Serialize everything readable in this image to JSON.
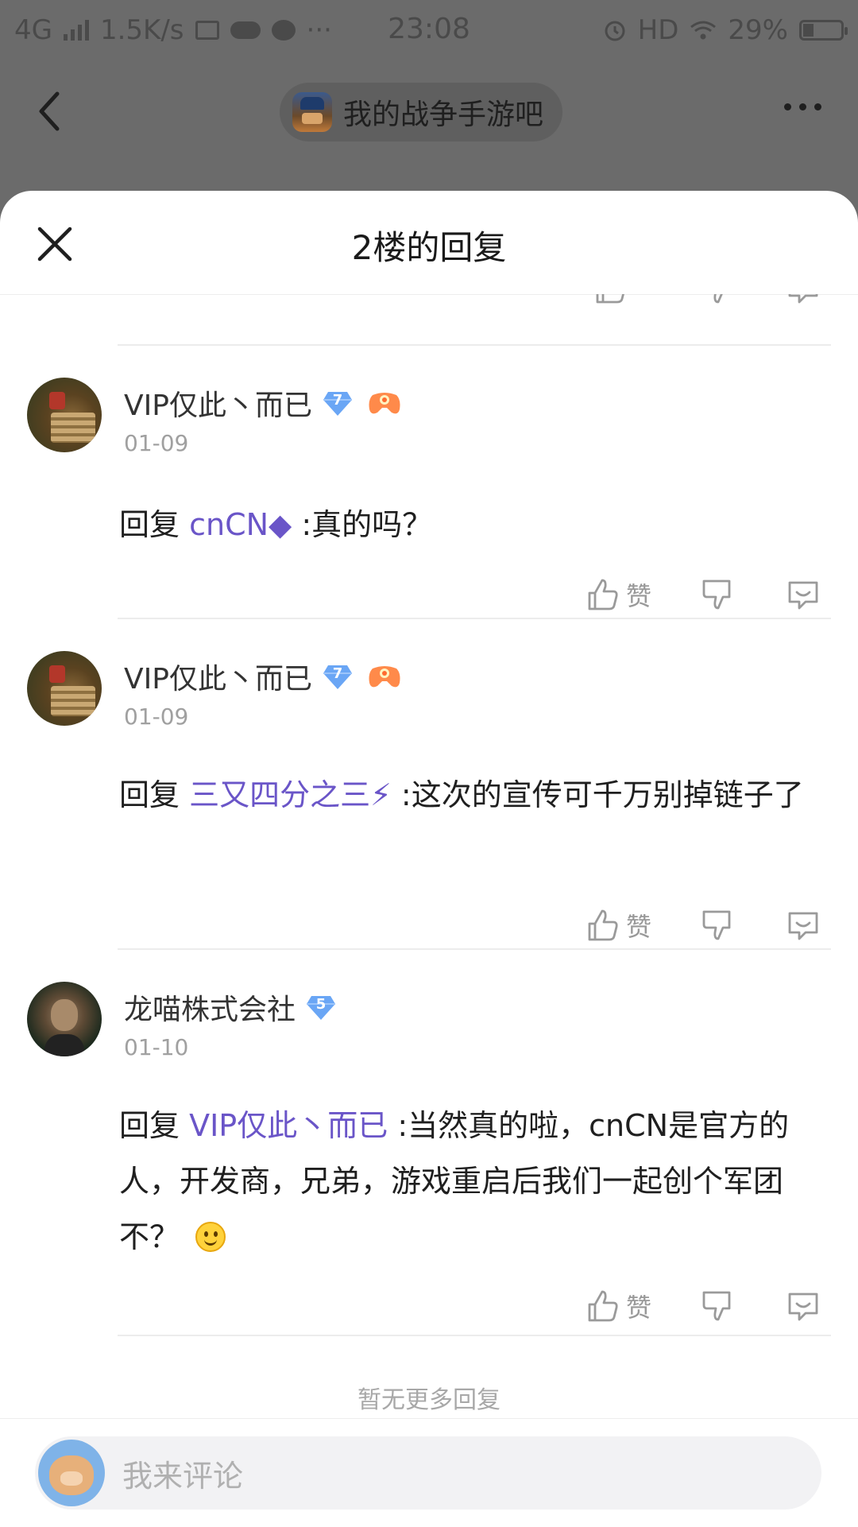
{
  "status_bar": {
    "network": "4G",
    "speed": "1.5K/s",
    "time": "23:08",
    "hd": "HD",
    "battery": "29%",
    "battery_level": 0.29
  },
  "nav": {
    "forum_name": "我的战争手游吧"
  },
  "sheet": {
    "title": "2楼的回复"
  },
  "replies": [
    {
      "username": "VIP仅此丶而已",
      "level": "7",
      "date": "01-09",
      "prefix": "回复",
      "mention": "cnCN◆",
      "text": ":真的吗？",
      "like_label": "赞"
    },
    {
      "username": "VIP仅此丶而已",
      "level": "7",
      "date": "01-09",
      "prefix": "回复",
      "mention": "三又四分之三⚡",
      "text": ":这次的宣传可千万别掉链子了",
      "like_label": "赞"
    },
    {
      "username": "龙喵株式会社",
      "level": "5",
      "date": "01-10",
      "prefix": "回复",
      "mention": "VIP仅此丶而已",
      "text": ":当然真的啦，cnCN是官方的人，开发商，兄弟，游戏重启后我们一起创个军团不？",
      "like_label": "赞"
    }
  ],
  "no_more_text": "暂无更多回复",
  "comment_bar": {
    "placeholder": "我来评论"
  },
  "colors": {
    "accent": "#6a55c8",
    "badge_blue": "#6aa6f5",
    "muted": "#a0a0a0"
  }
}
